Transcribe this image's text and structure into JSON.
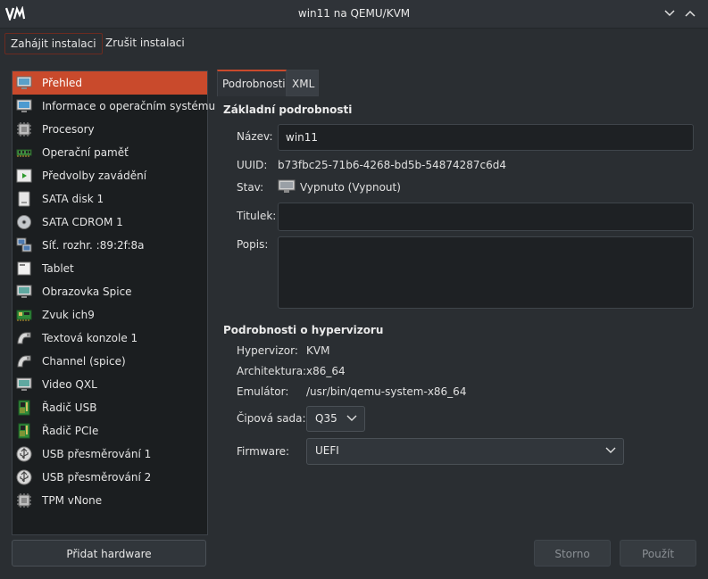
{
  "window": {
    "title": "win11 na QEMU/KVM"
  },
  "toolbar": {
    "begin_install": "Zahájit instalaci",
    "cancel_install": "Zrušit instalaci"
  },
  "sidebar": {
    "items": [
      {
        "label": "Přehled",
        "icon": "overview-icon",
        "active": true
      },
      {
        "label": "Informace o operačním systému",
        "icon": "os-info-icon"
      },
      {
        "label": "Procesory",
        "icon": "cpu-icon"
      },
      {
        "label": "Operační paměť",
        "icon": "memory-icon"
      },
      {
        "label": "Předvolby zavádění",
        "icon": "boot-options-icon"
      },
      {
        "label": "SATA disk 1",
        "icon": "disk-icon"
      },
      {
        "label": "SATA CDROM 1",
        "icon": "cdrom-icon"
      },
      {
        "label": "Síť. rozhr. :89:2f:8a",
        "icon": "network-icon"
      },
      {
        "label": "Tablet",
        "icon": "tablet-icon"
      },
      {
        "label": "Obrazovka Spice",
        "icon": "display-icon"
      },
      {
        "label": "Zvuk ich9",
        "icon": "sound-card-icon"
      },
      {
        "label": "Textová konzole 1",
        "icon": "console-icon"
      },
      {
        "label": "Channel (spice)",
        "icon": "channel-icon"
      },
      {
        "label": "Video QXL",
        "icon": "video-icon"
      },
      {
        "label": "Řadič USB",
        "icon": "usb-controller-icon"
      },
      {
        "label": "Řadič PCIe",
        "icon": "pcie-controller-icon"
      },
      {
        "label": "USB přesměrování 1",
        "icon": "usb-redirect-icon"
      },
      {
        "label": "USB přesměrování 2",
        "icon": "usb-redirect-icon"
      },
      {
        "label": "TPM vNone",
        "icon": "tpm-icon"
      }
    ],
    "add_hardware": "Přidat hardware"
  },
  "tabs": [
    {
      "label": "Podrobnosti",
      "active": true
    },
    {
      "label": "XML",
      "active": false
    }
  ],
  "details": {
    "section_title": "Základní podrobnosti",
    "name_label": "Název:",
    "name_value": "win11",
    "uuid_label": "UUID:",
    "uuid_value": "b73fbc25-71b6-4268-bd5b-54874287c6d4",
    "status_label": "Stav:",
    "status_value": "Vypnuto (Vypnout)",
    "title_label": "Titulek:",
    "title_value": "",
    "description_label": "Popis:",
    "description_value": ""
  },
  "hypervisor": {
    "section_title": "Podrobnosti o hypervizoru",
    "hypervisor_label": "Hypervizor:",
    "hypervisor_value": "KVM",
    "arch_label": "Architektura:",
    "arch_value": "x86_64",
    "emulator_label": "Emulátor:",
    "emulator_value": "/usr/bin/qemu-system-x86_64",
    "chipset_label": "Čipová sada:",
    "chipset_value": "Q35",
    "firmware_label": "Firmware:",
    "firmware_value": "UEFI"
  },
  "actions": {
    "cancel": "Storno",
    "apply": "Použít"
  },
  "colors": {
    "accent": "#c94a2c",
    "background": "#2a2e32",
    "sidebar_bg": "#1b1e20"
  }
}
